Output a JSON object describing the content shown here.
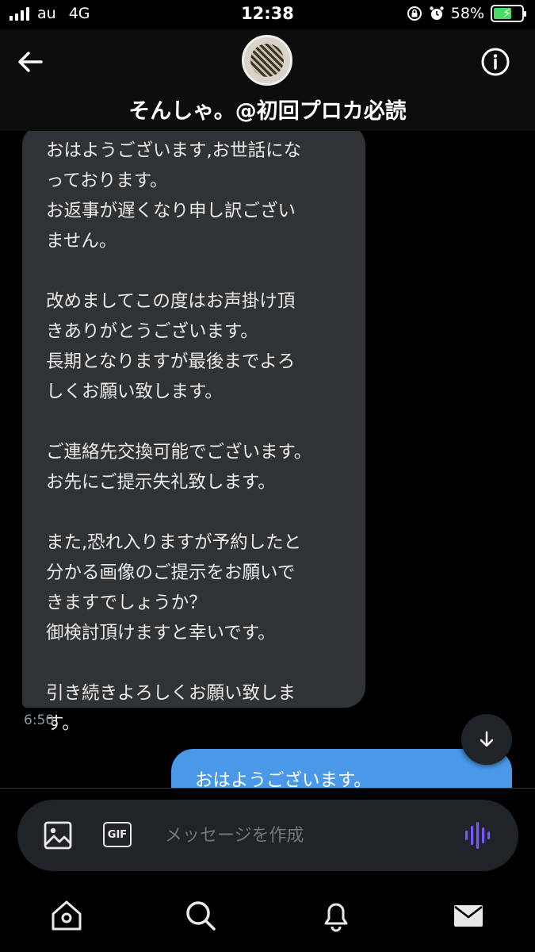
{
  "status_bar": {
    "carrier": "au",
    "network": "4G",
    "time": "12:38",
    "battery_percent": "58%",
    "battery_level": 0.58,
    "icons": [
      "signal-icon",
      "rotation-lock-icon",
      "alarm-icon",
      "battery-charging-icon"
    ]
  },
  "header": {
    "contact_name": "そんしゃ。@初回プロカ必読",
    "back_icon": "back-arrow-icon",
    "info_icon": "info-icon"
  },
  "messages": {
    "received": {
      "text": "おはようございます,お世話にな\nっております。\nお返事が遅くなり申し訳ござい\nません。\n\n改めましてこの度はお声掛け頂\nきありがとうございます。\n長期となりますが最後までよろ\nしくお願い致します。\n\nご連絡先交換可能でございます。\nお先にご提示失礼致します。\n\nまた,恐れ入りますが予約したと\n分かる画像のご提示をお願いで\nきますでしょうか？\n御検討頂けますと幸いです。\n\n引き続きよろしくお願い致しま\nす。",
      "time": "6:50"
    },
    "sent": {
      "text": "おはようございます。"
    }
  },
  "composer": {
    "placeholder": "メッセージを作成",
    "gif_label": "GIF",
    "icons": [
      "image-icon",
      "gif-icon",
      "voice-message-icon"
    ]
  },
  "nav": {
    "items": [
      "home-icon",
      "search-icon",
      "notifications-icon",
      "messages-icon"
    ]
  },
  "colors": {
    "background": "#000000",
    "received_bubble": "#2f3336",
    "sent_bubble": "#4a99e9",
    "voice_accent": "#7856ff",
    "battery_fill": "#4cd964"
  }
}
